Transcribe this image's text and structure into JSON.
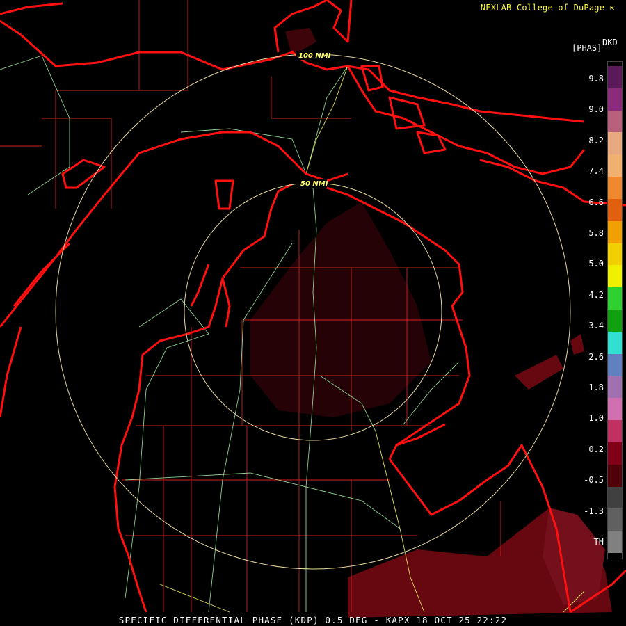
{
  "header": {
    "credit": "NEXLAB-College of DuPage",
    "credit_icon": "diagonal-arrow-icon"
  },
  "legend": {
    "unit_top": "DKD",
    "unit": "[PHAS]",
    "ticks": [
      "9.8",
      "9.0",
      "8.2",
      "7.4",
      "6.6",
      "5.8",
      "5.0",
      "4.2",
      "3.4",
      "2.6",
      "1.8",
      "1.0",
      "0.2",
      "-0.5",
      "-1.3",
      "TH"
    ],
    "colors": [
      "#5a1a5a",
      "#8c2a7c",
      "#b8607c",
      "#e8a880",
      "#f0b070",
      "#f08830",
      "#e06010",
      "#f0a000",
      "#f0d000",
      "#f0f000",
      "#30d030",
      "#10a010",
      "#30e0d0",
      "#6080c0",
      "#a070b0",
      "#d070b0",
      "#c03060",
      "#800018",
      "#500008",
      "#404040",
      "#606060",
      "#808080"
    ]
  },
  "rings": {
    "inner_label": "50 NMI",
    "outer_label": "100 NMI"
  },
  "colors": {
    "border": "#ff1010",
    "county": "#d02020",
    "highway": "#90d090",
    "road_yellow": "#e0e060",
    "ring": "#e8d8a0",
    "echo": "#7a0a14"
  },
  "footer": {
    "caption": "SPECIFIC DIFFERENTIAL PHASE (KDP) 0.5 DEG - KAPX 18 OCT 25 22:22"
  }
}
